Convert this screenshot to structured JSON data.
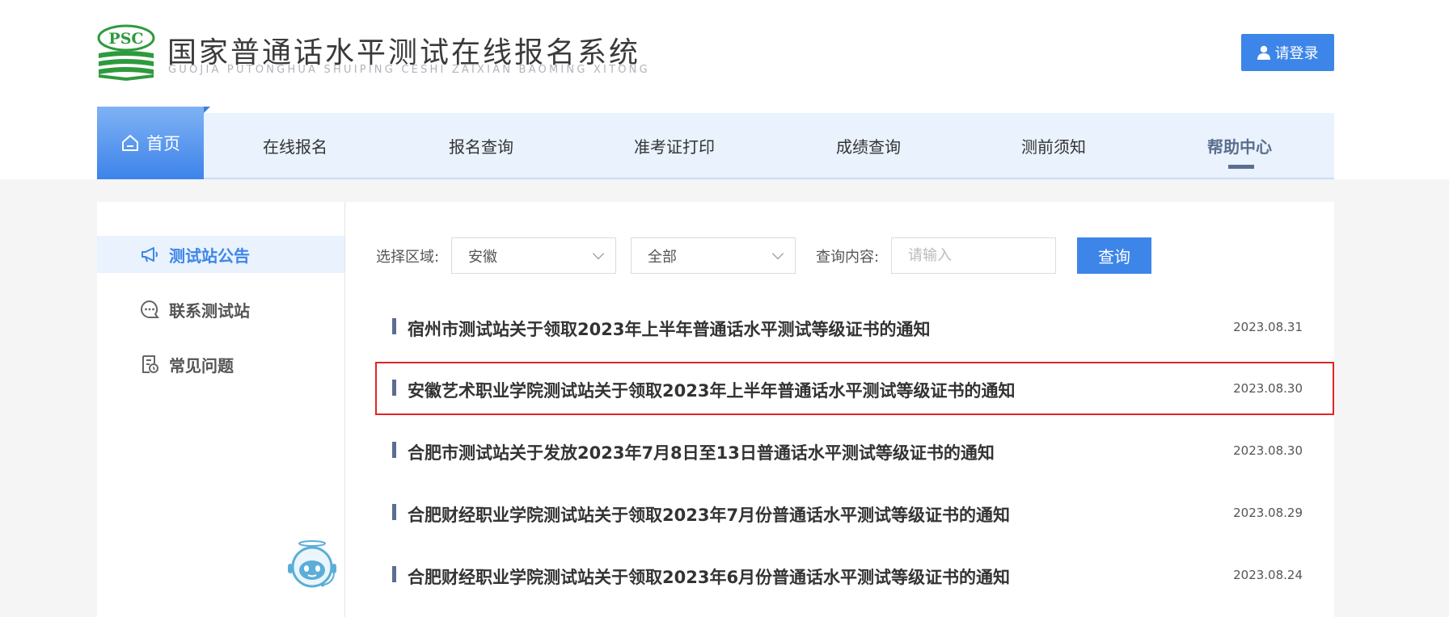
{
  "header": {
    "logo_text": "PSC",
    "title": "国家普通话水平测试在线报名系统",
    "subtitle": "GUOJIA PUTONGHUA SHUIPING CESHI ZAIXIAN BAOMING XITONG",
    "login_label": "请登录",
    "login_icon": "user-icon"
  },
  "nav": {
    "home": "首页",
    "items": [
      "在线报名",
      "报名查询",
      "准考证打印",
      "成绩查询",
      "测前须知",
      "帮助中心"
    ],
    "active": "帮助中心"
  },
  "sidebar": {
    "items": [
      {
        "label": "测试站公告",
        "icon": "megaphone-icon",
        "active": true
      },
      {
        "label": "联系测试站",
        "icon": "chat-bubble-icon",
        "active": false
      },
      {
        "label": "常见问题",
        "icon": "faq-document-icon",
        "active": false
      }
    ]
  },
  "filters": {
    "region_label": "选择区域:",
    "region_value": "安徽",
    "scope_value": "全部",
    "query_label": "查询内容:",
    "query_placeholder": "请输入",
    "search_label": "查询"
  },
  "notices": [
    {
      "title": "宿州市测试站关于领取2023年上半年普通话水平测试等级证书的通知",
      "date": "2023.08.31",
      "highlighted": false
    },
    {
      "title": "安徽艺术职业学院测试站关于领取2023年上半年普通话水平测试等级证书的通知",
      "date": "2023.08.30",
      "highlighted": true
    },
    {
      "title": "合肥市测试站关于发放2023年7月8日至13日普通话水平测试等级证书的通知",
      "date": "2023.08.30",
      "highlighted": false
    },
    {
      "title": "合肥财经职业学院测试站关于领取2023年7月份普通话水平测试等级证书的通知",
      "date": "2023.08.29",
      "highlighted": false
    },
    {
      "title": "合肥财经职业学院测试站关于领取2023年6月份普通话水平测试等级证书的通知",
      "date": "2023.08.24",
      "highlighted": false
    }
  ],
  "colors": {
    "primary": "#3d85e8",
    "nav_bg": "#e9f2fd",
    "active_nav": "#5b6e8f",
    "highlight_border": "#e02525",
    "logo_green": "#2e9a3e"
  }
}
